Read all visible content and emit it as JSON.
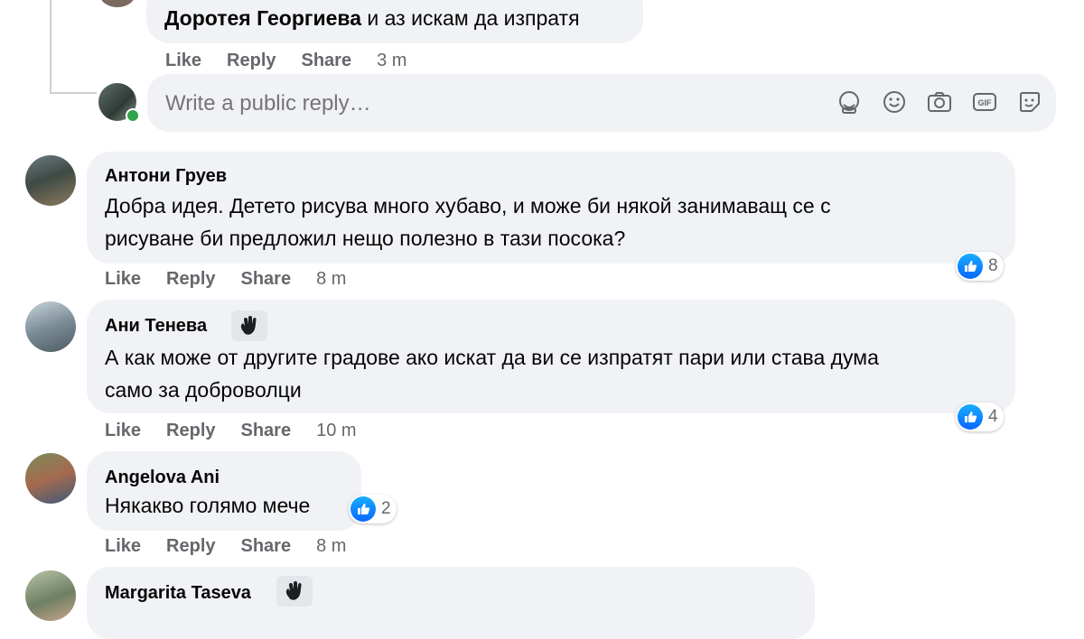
{
  "top_reply": {
    "author": "Доротея Георгиева",
    "text": "и аз искам да изпратя",
    "actions": {
      "like": "Like",
      "reply": "Reply",
      "share": "Share",
      "time": "3 m"
    }
  },
  "reply_box": {
    "placeholder": "Write a public reply…",
    "tools": [
      "avatar-sticker-icon",
      "emoji-icon",
      "camera-icon",
      "gif-icon",
      "sticker-icon"
    ]
  },
  "comments": [
    {
      "author": "Антони Груев",
      "lines": [
        "Добра идея. Детето рисува много хубаво, и може би някой занимаващ се с",
        "рисуване би предложил нещо полезно в тази посока?"
      ],
      "reactions": "8",
      "actions": {
        "like": "Like",
        "reply": "Reply",
        "share": "Share",
        "time": "8 m"
      }
    },
    {
      "author": "Ани Тенева",
      "lines": [
        "А как може от другите градове ако искат да ви се изпратят пари или става дума",
        "само за доброволци"
      ],
      "reactions": "4",
      "actions": {
        "like": "Like",
        "reply": "Reply",
        "share": "Share",
        "time": "10 m"
      }
    },
    {
      "author": "Angelova Ani",
      "lines": [
        "Някакво голямо мече"
      ],
      "reactions": "2",
      "actions": {
        "like": "Like",
        "reply": "Reply",
        "share": "Share",
        "time": "8 m"
      }
    },
    {
      "author": "Margarita Taseva",
      "lines": []
    }
  ],
  "colors": {
    "bubble": "#f0f2f5",
    "secondary_text": "#65676b",
    "like_blue": "#0866ff",
    "online_green": "#31a24c"
  }
}
